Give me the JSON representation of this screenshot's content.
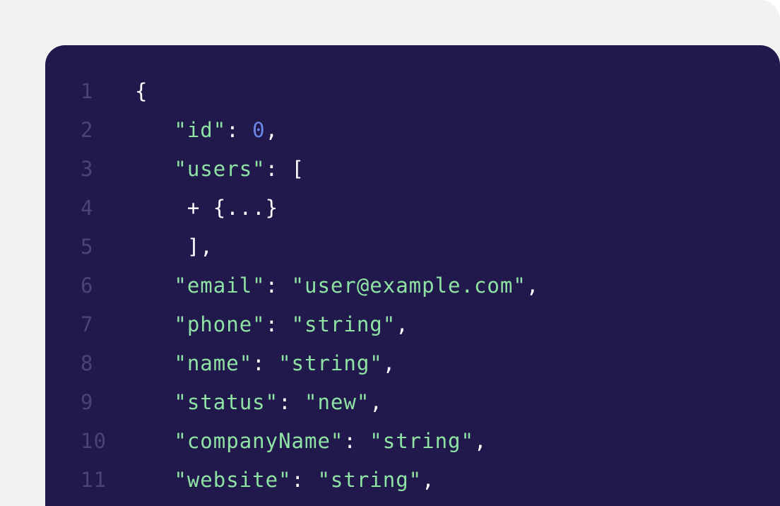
{
  "colors": {
    "page_background": "#f1f2f4",
    "editor_background": "#21184b",
    "line_number": "#4a4570",
    "key_string": "#8ee3a4",
    "number": "#6b87e8",
    "punctuation": "#ffffff"
  },
  "lines": [
    {
      "number": "1",
      "tokens": [
        "{"
      ]
    },
    {
      "number": "2",
      "tokens": [
        "   ",
        "\"id\"",
        ": ",
        "0",
        ","
      ]
    },
    {
      "number": "3",
      "tokens": [
        "   ",
        "\"users\"",
        ": ["
      ]
    },
    {
      "number": "4",
      "tokens": [
        "    + {...}"
      ]
    },
    {
      "number": "5",
      "tokens": [
        "    ],"
      ]
    },
    {
      "number": "6",
      "tokens": [
        "   ",
        "\"email\"",
        ": ",
        "\"user@example.com\"",
        ","
      ]
    },
    {
      "number": "7",
      "tokens": [
        "   ",
        "\"phone\"",
        ": ",
        "\"string\"",
        ","
      ]
    },
    {
      "number": "8",
      "tokens": [
        "   ",
        "\"name\"",
        ": ",
        "\"string\"",
        ","
      ]
    },
    {
      "number": "9",
      "tokens": [
        "   ",
        "\"status\"",
        ": ",
        "\"new\"",
        ","
      ]
    },
    {
      "number": "10",
      "tokens": [
        "   ",
        "\"companyName\"",
        ": ",
        "\"string\"",
        ","
      ]
    },
    {
      "number": "11",
      "tokens": [
        "   ",
        "\"website\"",
        ": ",
        "\"string\"",
        ","
      ]
    }
  ]
}
